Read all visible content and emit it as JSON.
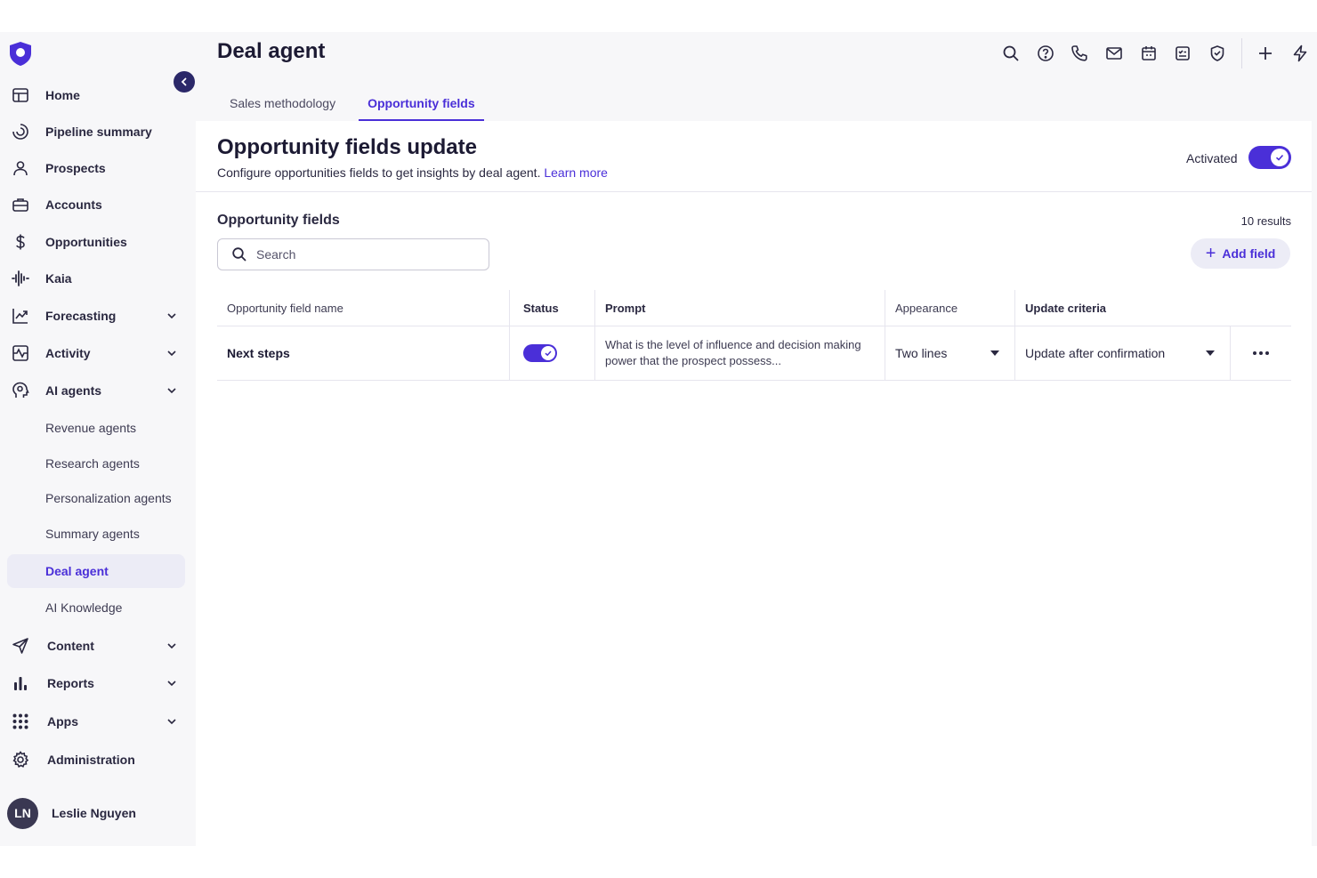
{
  "colors": {
    "accent": "#4a2fd8",
    "sidebar_dark": "#2b2869"
  },
  "sidebar": {
    "logo_icon": "shield-logo-icon",
    "items": [
      {
        "label": "Home",
        "icon": "layout-icon"
      },
      {
        "label": "Pipeline summary",
        "icon": "pipeline-icon"
      },
      {
        "label": "Prospects",
        "icon": "person-icon"
      },
      {
        "label": "Accounts",
        "icon": "briefcase-icon"
      },
      {
        "label": "Opportunities",
        "icon": "dollar-icon"
      },
      {
        "label": "Kaia",
        "icon": "waveform-icon"
      },
      {
        "label": "Forecasting",
        "icon": "trend-chart-icon"
      },
      {
        "label": "Activity",
        "icon": "activity-icon"
      },
      {
        "label": "AI agents",
        "icon": "agent-head-icon"
      }
    ],
    "ai_agents_sub": [
      {
        "label": "Revenue agents"
      },
      {
        "label": "Research agents"
      },
      {
        "label": "Personalization agents"
      },
      {
        "label": "Summary agents"
      },
      {
        "label": "Deal agent"
      },
      {
        "label": "AI Knowledge"
      }
    ],
    "bottom_items": [
      {
        "label": "Content",
        "icon": "send-icon"
      },
      {
        "label": "Reports",
        "icon": "bar-chart-icon"
      },
      {
        "label": "Apps",
        "icon": "grid-icon"
      },
      {
        "label": "Administration",
        "icon": "gear-icon"
      }
    ],
    "user": {
      "initials": "LN",
      "name": "Leslie Nguyen"
    }
  },
  "header": {
    "title": "Deal agent",
    "icons": [
      "search-icon",
      "help-icon",
      "phone-icon",
      "mail-icon",
      "calendar-icon",
      "task-icon",
      "badge-icon",
      "plus-icon",
      "bolt-icon"
    ]
  },
  "tabs": [
    {
      "label": "Sales methodology"
    },
    {
      "label": "Opportunity fields"
    }
  ],
  "update": {
    "title": "Opportunity fields update",
    "description": "Configure opportunities fields to get insights by deal agent.",
    "learn_more": "Learn more",
    "activated_label": "Activated",
    "activated": true
  },
  "fields": {
    "title": "Opportunity fields",
    "results": "10 results",
    "search_placeholder": "Search",
    "add_label": "Add field",
    "columns": [
      "Opportunity field name",
      "Status",
      "Prompt",
      "Appearance",
      "Update criteria"
    ],
    "rows": [
      {
        "name": "Next steps",
        "status": true,
        "prompt": "What is the level of influence and decision making power that the prospect possess...",
        "appearance": "Two lines",
        "criteria": "Update after confirmation"
      }
    ]
  }
}
